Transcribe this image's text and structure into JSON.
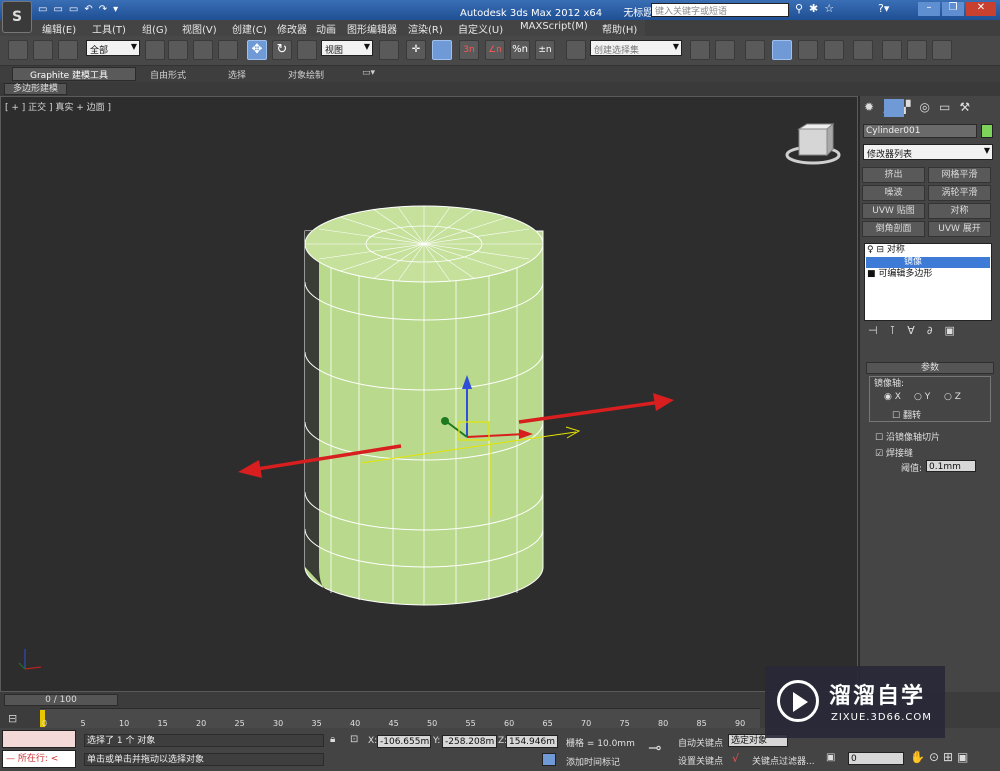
{
  "title": {
    "app": "Autodesk 3ds Max  2012 x64",
    "doc": "无标题",
    "search_placeholder": "键入关键字或短语"
  },
  "menu": [
    "编辑(E)",
    "工具(T)",
    "组(G)",
    "视图(V)",
    "创建(C)",
    "修改器",
    "动画",
    "图形编辑器",
    "渲染(R)",
    "自定义(U)",
    "MAXScript(M)",
    "帮助(H)"
  ],
  "toolbar": {
    "filter_value": "全部",
    "coord_value": "视图",
    "selection_set_placeholder": "创建选择集"
  },
  "ribbon": {
    "tabs": [
      "Graphite 建模工具",
      "自由形式",
      "选择",
      "对象绘制"
    ],
    "subtab": "多边形建模"
  },
  "viewport": {
    "label": "[ + ] 正交 ] 真实 + 边面 ]"
  },
  "command_panel": {
    "object_name": "Cylinder001",
    "object_color": "#7ed35a",
    "modifier_list": "修改器列表",
    "buttons": [
      "挤出",
      "网格平滑",
      "噪波",
      "涡轮平滑",
      "UVW 贴图",
      "对称",
      "倒角剖面",
      "UVW 展开"
    ],
    "stack": [
      {
        "label": "对称",
        "prefix": "♀ ⊟",
        "selected": false
      },
      {
        "label": "镜像",
        "prefix": "",
        "selected": true
      },
      {
        "label": "可编辑多边形",
        "prefix": "■",
        "selected": false
      }
    ],
    "params": {
      "title": "参数",
      "mirror_axis_label": "镜像轴:",
      "axes": [
        "X",
        "Y",
        "Z"
      ],
      "selected_axis": "X",
      "flip": "翻转",
      "slice": "沿镜像轴切片",
      "slice_checked": false,
      "weld": "焊接缝",
      "weld_checked": true,
      "threshold_label": "阈值:",
      "threshold_value": "0.1mm"
    }
  },
  "timeline": {
    "frame": "0 / 100",
    "ticks": [
      "0",
      "5",
      "10",
      "15",
      "20",
      "25",
      "30",
      "35",
      "40",
      "45",
      "50",
      "55",
      "60",
      "65",
      "70",
      "75",
      "80",
      "85",
      "90"
    ]
  },
  "status": {
    "running_label": "所在行:",
    "selected_text": "选择了 1 个 对象",
    "prompt_text": "单击或单击并拖动以选择对象",
    "x_label": "X:",
    "x_value": "-106.655m",
    "y_label": "Y:",
    "y_value": "-258.208m",
    "z_label": "Z:",
    "z_value": "154.946m",
    "grid": "栅格 = 10.0mm",
    "add_time_tag": "添加时间标记",
    "auto_key": "自动关键点",
    "auto_key_value": "选定对象",
    "set_key": "设置关键点",
    "key_filter": "关键点过滤器...",
    "frame_field": "0"
  },
  "watermark": {
    "name": "溜溜自学",
    "url": "ZIXUE.3D66.COM"
  },
  "colors": {
    "cylinder": "#b9d98c",
    "arrow": "#d81e1e"
  }
}
